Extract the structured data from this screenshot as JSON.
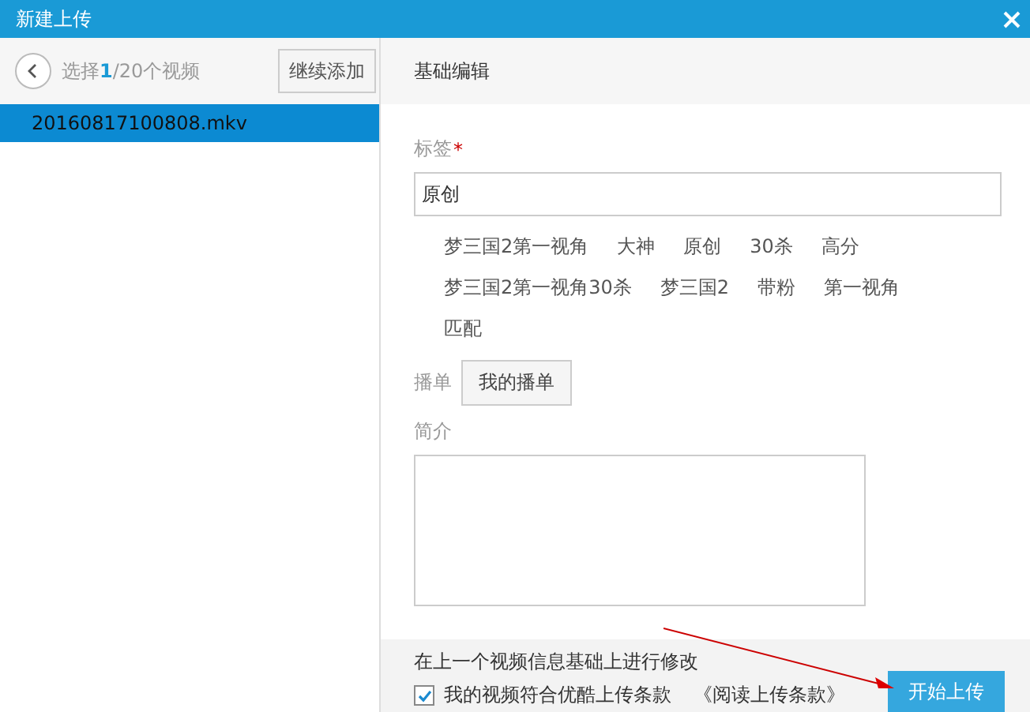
{
  "window": {
    "title": "新建上传"
  },
  "sidebar": {
    "selection": {
      "before": "选择",
      "highlight": "1",
      "after": "/20个视频"
    },
    "add_button": "继续添加",
    "items": [
      {
        "label": "20160817100808.mkv",
        "selected": true
      }
    ]
  },
  "editor": {
    "heading": "基础编辑",
    "tags_label": "标签",
    "required_mark": "*",
    "tags_value": "原创",
    "suggested_tags": [
      [
        "梦三国2第一视角",
        "大神",
        "原创",
        "30杀",
        "高分"
      ],
      [
        "梦三国2第一视角30杀",
        "梦三国2",
        "带粉",
        "第一视角"
      ],
      [
        "匹配"
      ]
    ],
    "playlist_label": "播单",
    "playlist_button": "我的播单",
    "intro_label": "简介"
  },
  "footer": {
    "note": "在上一个视频信息基础上进行修改",
    "agree": {
      "label": "我的视频符合优酷上传条款",
      "checked": true
    },
    "terms_link": "《阅读上传条款》",
    "submit": "开始上传"
  }
}
